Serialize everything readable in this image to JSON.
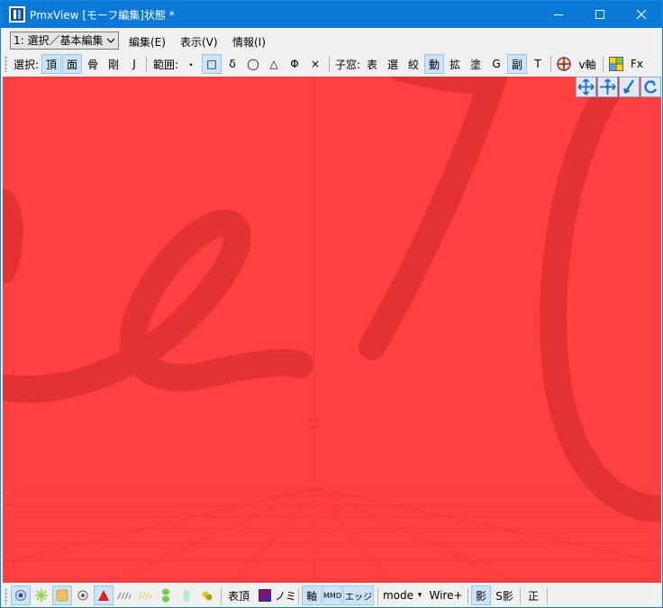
{
  "window": {
    "title": "PmxView  [モーフ編集]状態 *",
    "minimize_glyph": "—",
    "maximize_glyph": "☐",
    "close_glyph": "✕"
  },
  "menubar": {
    "mode_select": "1: 選択／基本編集",
    "edit": "編集(E)",
    "view": "表示(V)",
    "info": "情報(I)"
  },
  "toolbar": {
    "select_label": "選択:",
    "vertex": "頂",
    "face": "面",
    "bone": "骨",
    "rigid": "剛",
    "joint": "J",
    "range_label": "範囲:",
    "range_dot": "・",
    "range_rect": "□",
    "range_delta": "δ",
    "range_circle": "◯",
    "range_triangle": "△",
    "range_phi": "Φ",
    "range_x": "×",
    "child_label": "子窓:",
    "child_table": "表",
    "child_select": "選",
    "child_narrow": "絞",
    "child_move": "動",
    "child_scale": "拡",
    "child_paint": "塗",
    "child_g": "G",
    "child_sub": "副",
    "child_t": "T",
    "v_axis": "v軸",
    "fx": "Fx"
  },
  "bottombar": {
    "vertex_face": "表頂",
    "nomi": "ノミ",
    "axis": "軸",
    "mmd": "MMD",
    "edge": "エッジ",
    "mode": "mode",
    "mode_arrow": "▾",
    "wire": "Wire+",
    "shadow": "影",
    "s_shadow": "S影",
    "front": "正"
  },
  "colors": {
    "titlebar": "#0a78d7",
    "viewport_bg": "#ff4040",
    "stroke": "#e03030",
    "active_button": "#cce4f7"
  }
}
